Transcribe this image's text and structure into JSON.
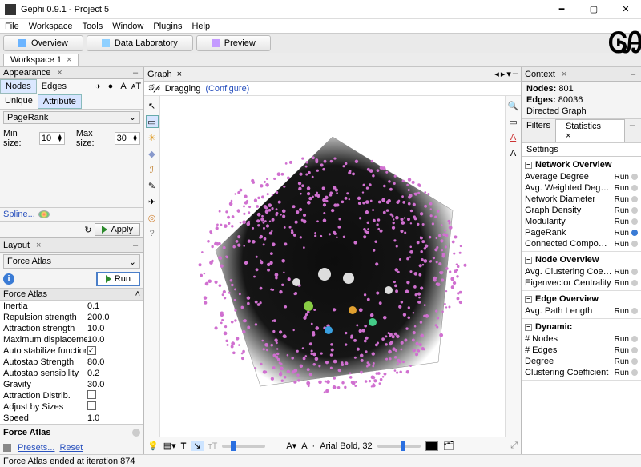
{
  "window": {
    "title": "Gephi 0.9.1 - Project 5"
  },
  "menus": [
    "File",
    "Workspace",
    "Tools",
    "Window",
    "Plugins",
    "Help"
  ],
  "perspectives": {
    "overview": "Overview",
    "datalab": "Data Laboratory",
    "preview": "Preview"
  },
  "workspace_tab": "Workspace 1",
  "appearance": {
    "title": "Appearance",
    "tabs": {
      "nodes": "Nodes",
      "edges": "Edges"
    },
    "modes": {
      "unique": "Unique",
      "attribute": "Attribute"
    },
    "attribute": "PageRank",
    "minsize_label": "Min size:",
    "minsize": "10",
    "maxsize_label": "Max size:",
    "maxsize": "30",
    "spline": "Spline...",
    "apply": "Apply"
  },
  "layout": {
    "title": "Layout",
    "algo": "Force Atlas",
    "run": "Run",
    "section": "Force Atlas",
    "params": [
      {
        "k": "Inertia",
        "v": "0.1"
      },
      {
        "k": "Repulsion strength",
        "v": "200.0"
      },
      {
        "k": "Attraction strength",
        "v": "10.0"
      },
      {
        "k": "Maximum displacemen",
        "v": "10.0"
      },
      {
        "k": "Auto stabilize function",
        "v": "",
        "chk": true,
        "on": true
      },
      {
        "k": "Autostab Strength",
        "v": "80.0"
      },
      {
        "k": "Autostab sensibility",
        "v": "0.2"
      },
      {
        "k": "Gravity",
        "v": "30.0"
      },
      {
        "k": "Attraction Distrib.",
        "v": "",
        "chk": true,
        "on": false
      },
      {
        "k": "Adjust by Sizes",
        "v": "",
        "chk": true,
        "on": false
      },
      {
        "k": "Speed",
        "v": "1.0"
      }
    ],
    "name": "Force Atlas",
    "presets": "Presets...",
    "reset": "Reset"
  },
  "graph": {
    "title": "Graph",
    "mode": "Dragging",
    "configure": "(Configure)"
  },
  "bottom": {
    "font": "Arial Bold, 32",
    "fontprefix": "A"
  },
  "context": {
    "title": "Context",
    "nodes_label": "Nodes:",
    "nodes": "801",
    "edges_label": "Edges:",
    "edges": "80036",
    "type": "Directed Graph"
  },
  "filters_tabs": {
    "filters": "Filters",
    "statistics": "Statistics"
  },
  "settings": "Settings",
  "stats": {
    "run": "Run",
    "groups": [
      {
        "title": "Network Overview",
        "items": [
          {
            "n": "Average Degree"
          },
          {
            "n": "Avg. Weighted Degree"
          },
          {
            "n": "Network Diameter"
          },
          {
            "n": "Graph Density"
          },
          {
            "n": "Modularity"
          },
          {
            "n": "PageRank",
            "done": true
          },
          {
            "n": "Connected Components"
          }
        ]
      },
      {
        "title": "Node Overview",
        "items": [
          {
            "n": "Avg. Clustering Coefficient"
          },
          {
            "n": "Eigenvector Centrality"
          }
        ]
      },
      {
        "title": "Edge Overview",
        "items": [
          {
            "n": "Avg. Path Length"
          }
        ]
      },
      {
        "title": "Dynamic",
        "items": [
          {
            "n": "# Nodes"
          },
          {
            "n": "# Edges"
          },
          {
            "n": "Degree"
          },
          {
            "n": "Clustering Coefficient"
          }
        ]
      }
    ]
  },
  "status": "Force Atlas ended at iteration 874"
}
